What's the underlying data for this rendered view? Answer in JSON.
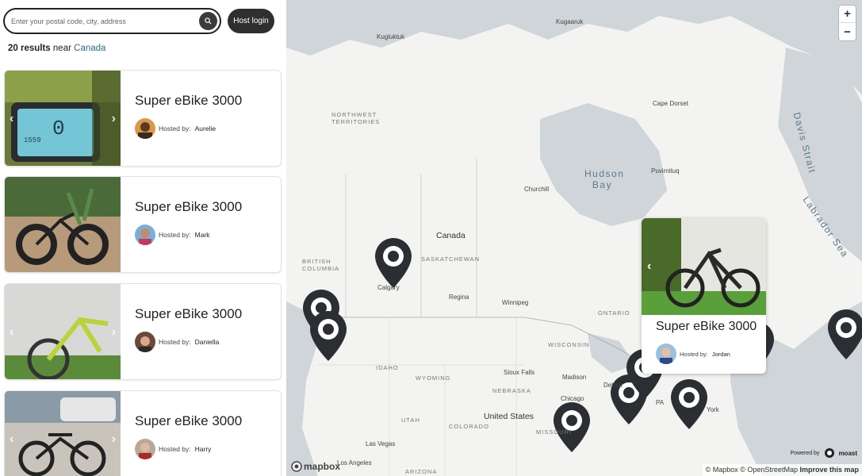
{
  "search": {
    "placeholder": "Enter your postal code, city, address"
  },
  "header": {
    "host_login_label": "Host login"
  },
  "results": {
    "count": "20 results",
    "near": "near",
    "place": "Canada"
  },
  "listings": [
    {
      "title": "Super eBike 3000",
      "host_label": "Hosted by:",
      "host_name": "Aurelie"
    },
    {
      "title": "Super eBike 3000",
      "host_label": "Hosted by:",
      "host_name": "Mark"
    },
    {
      "title": "Super eBike 3000",
      "host_label": "Hosted by:",
      "host_name": "Daniella"
    },
    {
      "title": "Super eBike 3000",
      "host_label": "Hosted by:",
      "host_name": "Harry"
    }
  ],
  "popup": {
    "title": "Super eBike 3000",
    "host_label": "Hosted by:",
    "host_name": "Jordan"
  },
  "map": {
    "labels": {
      "canada": "Canada",
      "united_states": "United States",
      "hudson_bay": "Hudson Bay",
      "davis_strait": "Davis Strait",
      "labrador_sea": "Labrador Sea",
      "northwest_territories": "NORTHWEST TERRITORIES",
      "saskatchewan": "SASKATCHEWAN",
      "british_columbia": "BRITISH COLUMBIA",
      "ontario": "ONTARIO",
      "idaho": "IDAHO",
      "wyoming": "WYOMING",
      "utah": "UTAH",
      "colorado": "COLORADO",
      "arizona": "ARIZONA",
      "nebraska": "NEBRASKA",
      "missouri": "MISSOURI",
      "wisconsin": "WISCONSIN",
      "kugluktuk": "Kugluktuk",
      "kugaaruk": "Kugaaruk",
      "cape_dorset": "Cape Dorset",
      "churchill": "Churchill",
      "puvirnituq": "Puvirnituq",
      "regina": "Regina",
      "winnipeg": "Winnipeg",
      "calgary": "Calgary",
      "sioux_falls": "Sioux Falls",
      "madison": "Madison",
      "chicago": "Chicago",
      "detroit": "Detroit",
      "las_vegas": "Las Vegas",
      "los_angeles": "Los Angeles",
      "new_york": "York",
      "pa": "PA"
    },
    "zoom_in": "+",
    "zoom_out": "−",
    "logo": "mapbox",
    "powered_by": "Powered by",
    "brand": "moast",
    "attribution": {
      "mapbox": "© Mapbox",
      "osm": "© OpenStreetMap",
      "improve": "Improve this map"
    }
  },
  "icons": [
    "search-icon",
    "chevron-left-icon",
    "chevron-right-icon",
    "map-pin-icon",
    "mapbox-logo-icon",
    "moast-logo-icon"
  ],
  "colors": {
    "pin": "#2b2e33",
    "button": "#2f2f2f",
    "water": "#cfd5d8",
    "land": "#f3f3f1",
    "link": "#2a6f8a"
  }
}
